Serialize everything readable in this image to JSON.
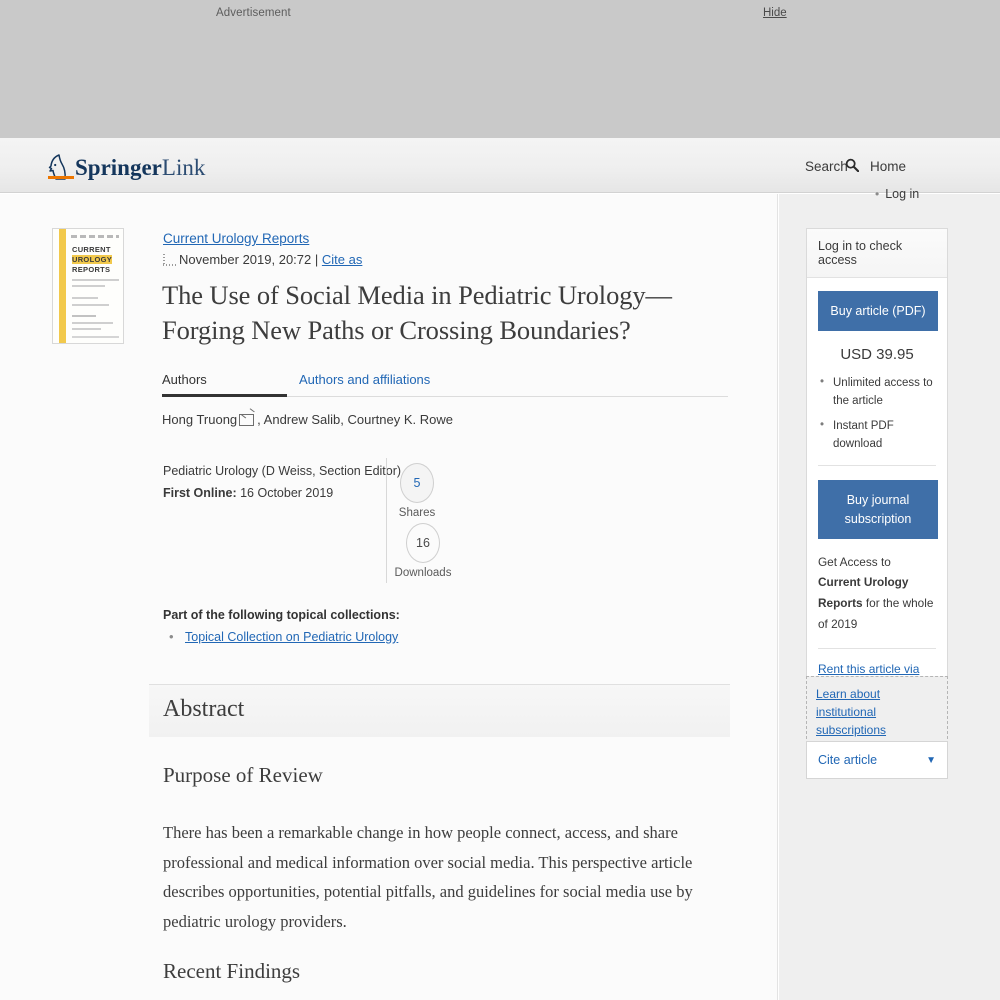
{
  "ad": {
    "label": "Advertisement",
    "hide": "Hide"
  },
  "header": {
    "logo_springer": "Springer",
    "logo_link": "Link",
    "search": "Search",
    "home": "Home",
    "login": "Log in",
    "search_icon": "search-icon"
  },
  "article": {
    "journal": "Current Urology Reports",
    "issue": "November 2019, 20:72",
    "separator": "|",
    "cite_as": "Cite as",
    "title": "The Use of Social Media in Pediatric Urology—Forging New Paths or Crossing Boundaries?",
    "tabs": [
      {
        "label": "Authors",
        "active": true
      },
      {
        "label": "Authors and affiliations",
        "active": false
      }
    ],
    "authors_prefix": "Hong Truong",
    "authors_rest": ", Andrew Salib, Courtney K. Rowe",
    "mail_icon": "envelope-icon",
    "section_editor": "Pediatric Urology (D Weiss, Section Editor)",
    "first_online_label": "First Online:",
    "first_online_value": " 16 October 2019",
    "metrics": [
      {
        "value": "5",
        "label": "Shares",
        "color": "#2167b5"
      },
      {
        "value": "16",
        "label": "Downloads",
        "color": "#4a4a4a"
      }
    ],
    "topical_heading": "Part of the following topical collections:",
    "topical_items": [
      "Topical Collection on Pediatric Urology"
    ]
  },
  "cover": {
    "line1": "CURRENT",
    "line2": "UROLOGY",
    "line3": "REPORTS"
  },
  "abstract": {
    "heading": "Abstract",
    "purpose_heading": "Purpose of Review",
    "purpose_text": "There has been a remarkable change in how people connect, access, and share professional and medical information over social media. This perspective article describes opportunities, potential pitfalls, and guidelines for social media use by pediatric urology providers.",
    "recent_heading": "Recent Findings"
  },
  "sidebar": {
    "access_heading": "Log in to check access",
    "buy_article": "Buy article (PDF)",
    "price": "USD 39.95",
    "perks": [
      "Unlimited access to the article",
      "Instant PDF download"
    ],
    "buy_journal": "Buy journal subscription",
    "get_access_pre": "Get Access to ",
    "get_access_bold": "Current Urology Reports",
    "get_access_post": " for the whole of 2019",
    "deepdyve": "Rent this article via DeepDyve",
    "institutional": "Learn about institutional subscriptions",
    "cite_article": "Cite article",
    "cite_caret": "▼"
  },
  "colors": {
    "link": "#2167b5",
    "button": "#3f6fa8",
    "brand_orange": "#ec7600",
    "brand_navy": "#14365c",
    "ad_bg": "#c9c9c9",
    "sidebar_bg": "#efefef"
  }
}
